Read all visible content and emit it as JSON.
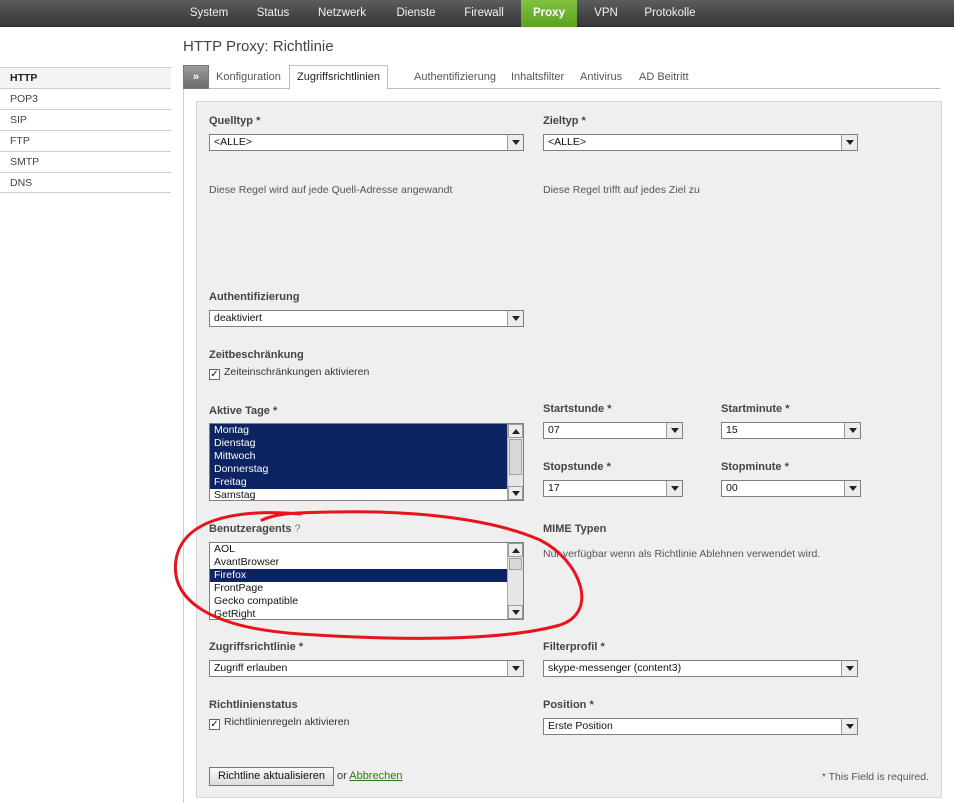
{
  "nav": {
    "items": [
      {
        "label": "System"
      },
      {
        "label": "Status"
      },
      {
        "label": "Netzwerk"
      },
      {
        "label": "Dienste"
      },
      {
        "label": "Firewall"
      },
      {
        "label": "Proxy",
        "active": true
      },
      {
        "label": "VPN"
      },
      {
        "label": "Protokolle"
      }
    ]
  },
  "page": {
    "title": "HTTP Proxy: Richtlinie"
  },
  "sidebar": {
    "items": [
      {
        "label": "HTTP",
        "active": true
      },
      {
        "label": "POP3"
      },
      {
        "label": "SIP"
      },
      {
        "label": "FTP"
      },
      {
        "label": "SMTP"
      },
      {
        "label": "DNS"
      }
    ]
  },
  "tabs": {
    "toggle": "»",
    "items": [
      {
        "label": "Konfiguration"
      },
      {
        "label": "Zugriffsrichtlinien",
        "active": true
      },
      {
        "label": "Authentifizierung"
      },
      {
        "label": "Inhaltsfilter"
      },
      {
        "label": "Antivirus"
      },
      {
        "label": "AD Beitritt"
      }
    ]
  },
  "form": {
    "quelltyp": {
      "label": "Quelltyp",
      "req": "*",
      "value": "<ALLE>",
      "hint": "Diese Regel wird auf jede Quell-Adresse angewandt"
    },
    "zieltyp": {
      "label": "Zieltyp",
      "req": "*",
      "value": "<ALLE>",
      "hint": "Diese Regel trifft auf jedes Ziel zu"
    },
    "auth": {
      "label": "Authentifizierung",
      "value": "deaktiviert"
    },
    "zeit": {
      "label": "Zeitbeschränkung",
      "checkbox_label": "Zeiteinschränkungen aktivieren",
      "checked": true
    },
    "tage": {
      "label": "Aktive Tage",
      "req": "*",
      "options": [
        "Montag",
        "Dienstag",
        "Mittwoch",
        "Donnerstag",
        "Freitag",
        "Samstag"
      ]
    },
    "startstunde": {
      "label": "Startstunde",
      "req": "*",
      "value": "07"
    },
    "startminute": {
      "label": "Startminute",
      "req": "*",
      "value": "15"
    },
    "stopstunde": {
      "label": "Stopstunde",
      "req": "*",
      "value": "17"
    },
    "stopminute": {
      "label": "Stopminute",
      "req": "*",
      "value": "00"
    },
    "agents": {
      "label": "Benutzeragents",
      "help": "?",
      "options": [
        "AOL",
        "AvantBrowser",
        "Firefox",
        "FrontPage",
        "Gecko compatible",
        "GetRight"
      ],
      "selected": "Firefox"
    },
    "mime": {
      "label": "MIME Typen",
      "hint": "Nur verfügbar wenn als Richtlinie Ablehnen verwendet wird."
    },
    "zugriff": {
      "label": "Zugriffsrichtlinie",
      "req": "*",
      "value": "Zugriff erlauben"
    },
    "filter": {
      "label": "Filterprofil",
      "req": "*",
      "value": "skype-messenger (content3)"
    },
    "status": {
      "label": "Richtlinienstatus",
      "checkbox_label": "Richtlinienregeln aktivieren",
      "checked": true
    },
    "position": {
      "label": "Position",
      "req": "*",
      "value": "Erste Position"
    }
  },
  "actions": {
    "submit": "Richtline aktualisieren",
    "or": "or",
    "cancel": "Abbrechen",
    "required_note": "* This Field is required."
  },
  "colors": {
    "accent": "#5da123",
    "selection": "#0c2461",
    "annotation": "#e8141c"
  }
}
